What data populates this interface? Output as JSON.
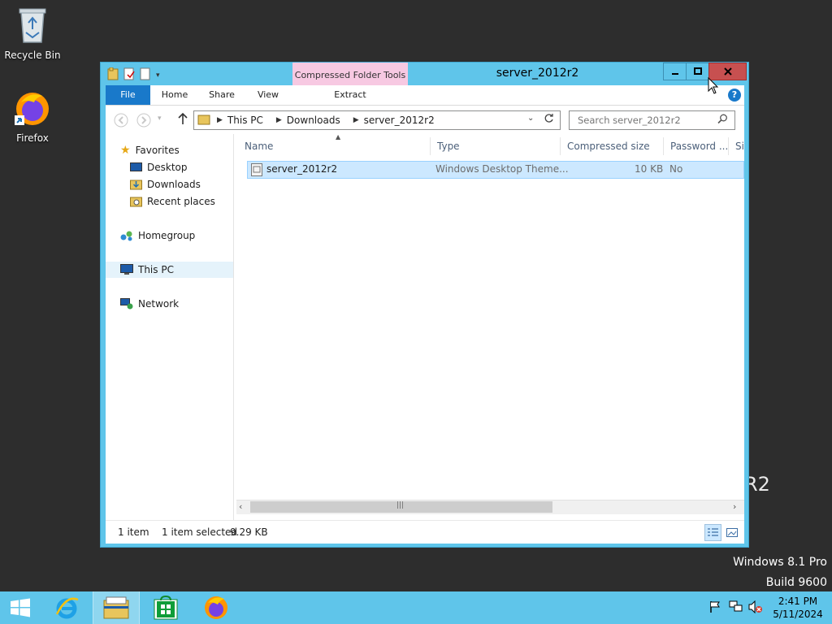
{
  "desktop": {
    "icons": [
      {
        "label": "Recycle Bin"
      },
      {
        "label": "Firefox"
      }
    ],
    "background_text": "R2",
    "watermark": {
      "line1": "Windows 8.1 Pro",
      "line2": "Build 9600"
    }
  },
  "window": {
    "title": "server_2012r2",
    "contextual_tab": "Compressed Folder Tools",
    "ribbon_tabs": [
      "File",
      "Home",
      "Share",
      "View",
      "Extract"
    ],
    "controls": {
      "minimize": "–",
      "maximize": "□",
      "close": "✕"
    }
  },
  "address": {
    "breadcrumbs": [
      "This PC",
      "Downloads",
      "server_2012r2"
    ]
  },
  "search": {
    "placeholder": "Search server_2012r2"
  },
  "nav_pane": {
    "favorites": "Favorites",
    "favorite_items": [
      "Desktop",
      "Downloads",
      "Recent places"
    ],
    "homegroup": "Homegroup",
    "this_pc": "This PC",
    "network": "Network"
  },
  "columns": [
    "Name",
    "Type",
    "Compressed size",
    "Password ...",
    "Si"
  ],
  "files": [
    {
      "name": "server_2012r2",
      "type": "Windows Desktop Theme...",
      "size": "10 KB",
      "password": "No"
    }
  ],
  "status": {
    "count": "1 item",
    "selected": "1 item selected",
    "size": "9.29 KB"
  },
  "taskbar": {
    "time": "2:41 PM",
    "date": "5/11/2024"
  },
  "colors": {
    "accent": "#5fc5ea",
    "file_tab": "#1979ca",
    "close": "#c75050",
    "context_tab": "#f7c9e2",
    "selection": "#cce8ff"
  }
}
